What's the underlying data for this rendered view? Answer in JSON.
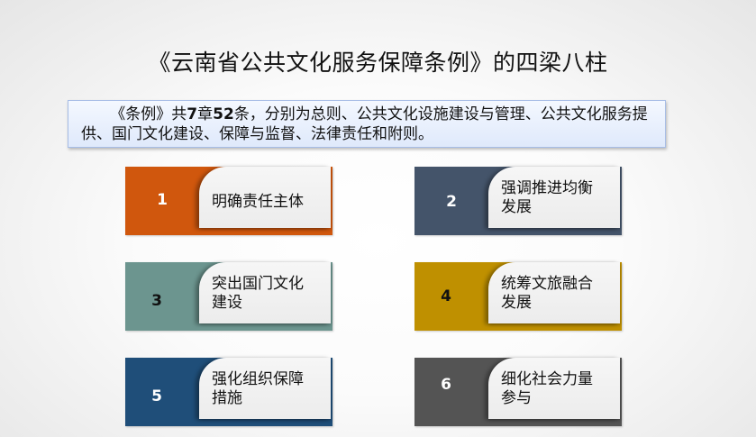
{
  "title": "《云南省公共文化服务保障条例》的四梁八柱",
  "summary": {
    "p1": "《条例》共",
    "ch": "7",
    "p2": "章",
    "art": "52",
    "p3": "条，分别为总则、公共文化设施建设与管理、公共文化服务提供、国门文化建设、保障与监督、法律责任和附则。"
  },
  "cards": [
    {
      "num": "1",
      "label": "明确责任主体",
      "color": "#d0570d",
      "num_color": "#ffffff"
    },
    {
      "num": "2",
      "label": "强调推进均衡发展",
      "color": "#44546a",
      "num_color": "#ffffff"
    },
    {
      "num": "3",
      "label": "突出国门文化建设",
      "color": "#6c958f",
      "num_color": "#111111"
    },
    {
      "num": "4",
      "label": "统筹文旅融合发展",
      "color": "#bf9000",
      "num_color": "#111111"
    },
    {
      "num": "5",
      "label": "强化组织保障措施",
      "color": "#1f4e79",
      "num_color": "#ffffff"
    },
    {
      "num": "6",
      "label": "细化社会力量参与",
      "color": "#545454",
      "num_color": "#ffffff"
    }
  ]
}
